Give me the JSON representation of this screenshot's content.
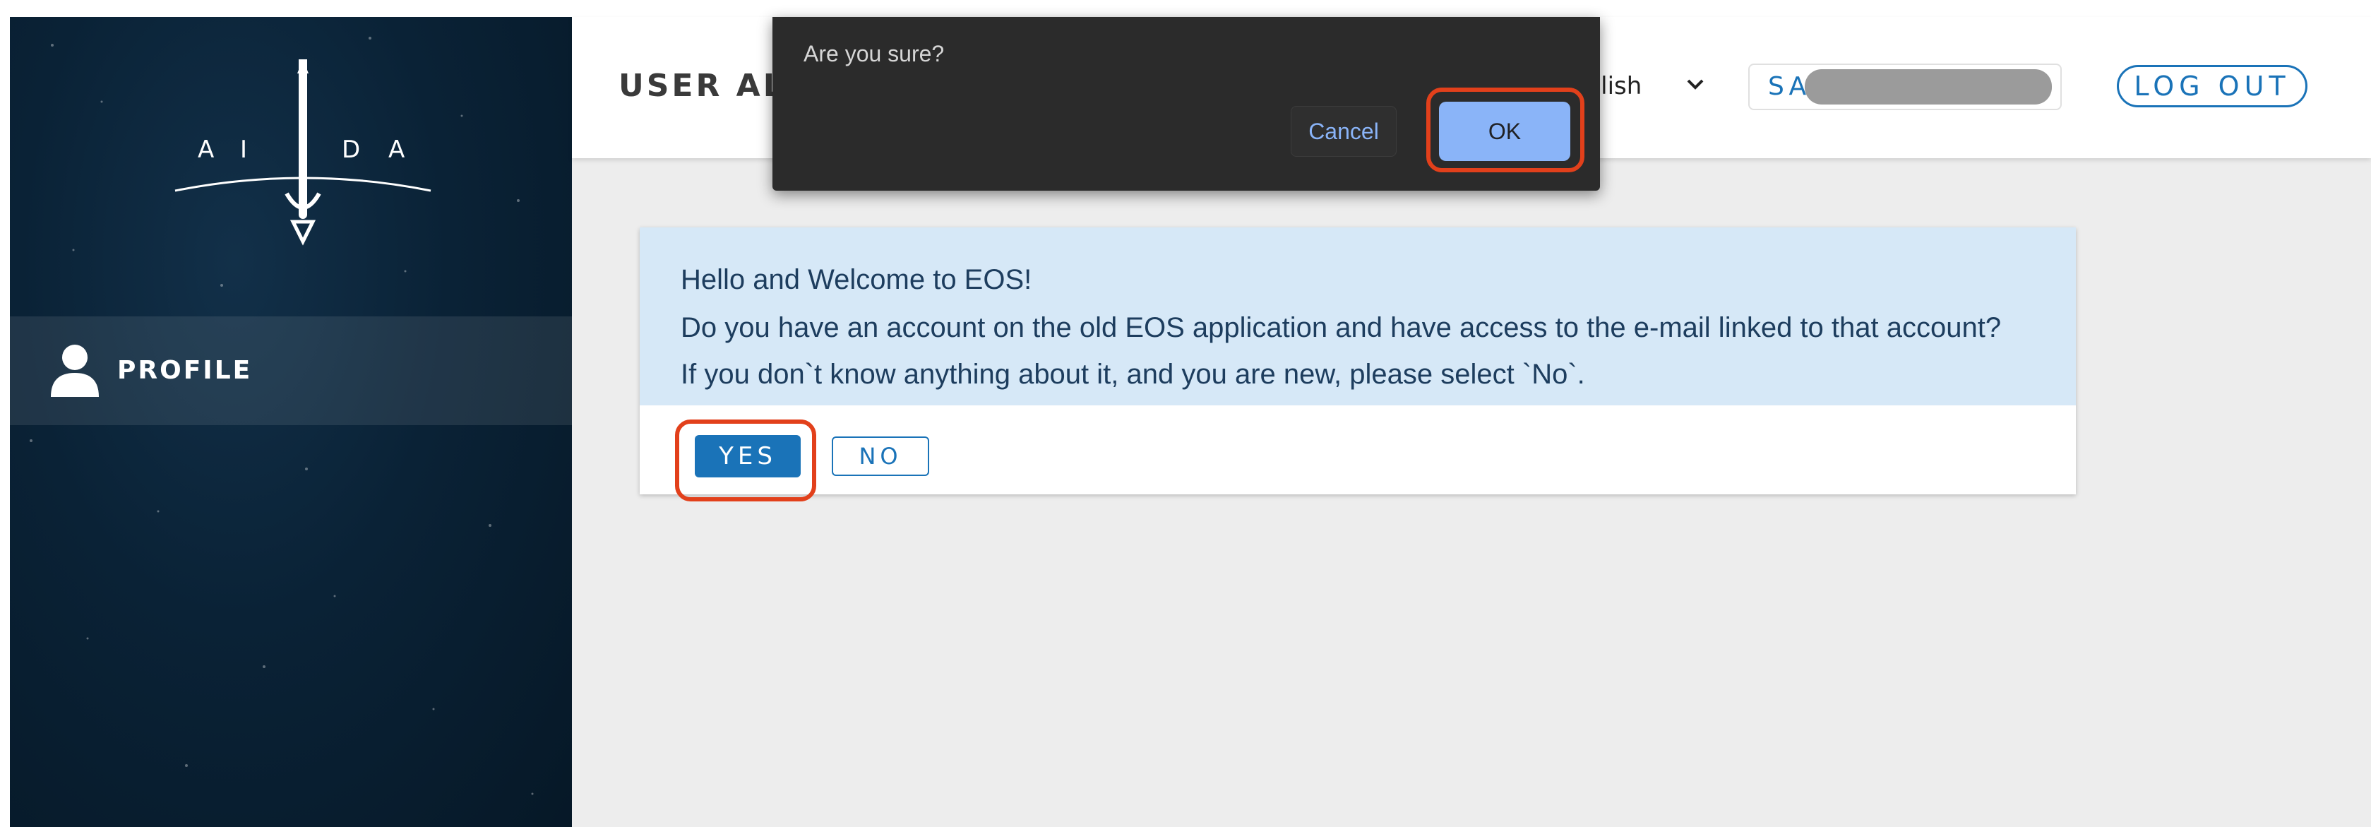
{
  "sidebar": {
    "logo_letters": [
      "A",
      "I",
      "D",
      "A"
    ],
    "nav": [
      {
        "label": "PROFILE",
        "icon": "user-icon"
      }
    ]
  },
  "header": {
    "title": "USER AL",
    "language": {
      "value": "nglish"
    },
    "user_field_prefix": "SA",
    "logout_label": "LOG OUT"
  },
  "welcome": {
    "lines": [
      "Hello and Welcome to EOS!",
      "Do you have an account on the old EOS application and have access to the e-mail linked to that account?",
      "If you don`t know anything about it, and you are new, please select `No`."
    ],
    "yes_label": "YES",
    "no_label": "NO"
  },
  "dialog": {
    "message": "Are you sure?",
    "cancel_label": "Cancel",
    "ok_label": "OK"
  },
  "colors": {
    "accent": "#1a73b8",
    "highlight": "#e2401b",
    "sidebar_bg": "#0a2236",
    "message_bg": "#d6e8f7"
  }
}
